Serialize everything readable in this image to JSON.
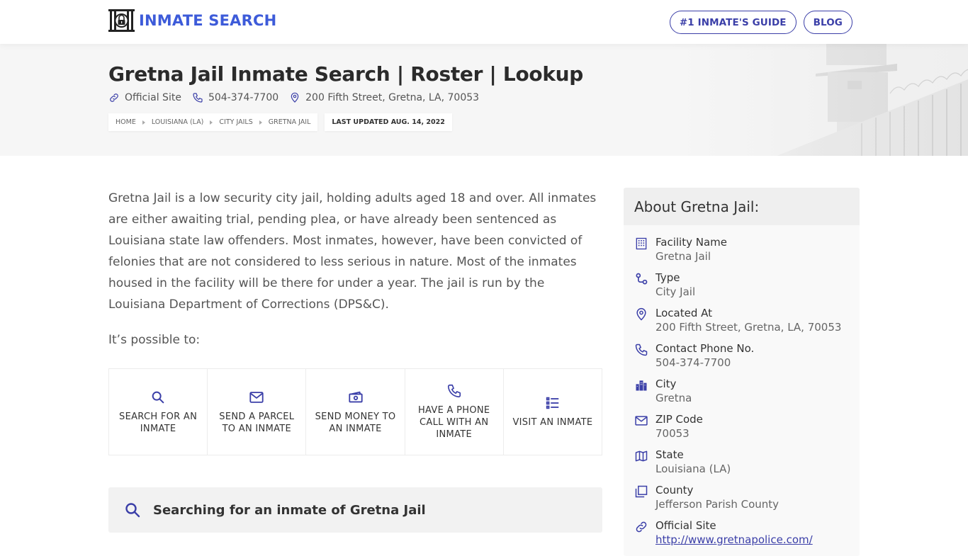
{
  "header": {
    "logo_text": "INMATE SEARCH",
    "logo_icon": "jail-lock-icon",
    "nav": [
      {
        "label": "#1 INMATE'S GUIDE"
      },
      {
        "label": "BLOG"
      }
    ]
  },
  "hero": {
    "title": "Gretna Jail Inmate Search | Roster | Lookup",
    "official_site_label": "Official Site",
    "phone": "504-374-7700",
    "address": "200 Fifth Street, Gretna, LA, 70053",
    "breadcrumbs": [
      {
        "label": "HOME"
      },
      {
        "label": "LOUISIANA (LA)"
      },
      {
        "label": "CITY JAILS"
      },
      {
        "label": "GRETNA JAIL"
      }
    ],
    "last_updated": "LAST UPDATED AUG. 14, 2022"
  },
  "main": {
    "intro": "Gretna Jail is a low security city jail, holding adults aged 18 and over. All inmates are either awaiting trial, pending plea, or have already been sentenced as Louisiana state law offenders. Most inmates, however, have been convicted of felonies that are not considered to less serious in nature. Most of the inmates housed in the facility will be there for under a year. The jail is run by the Louisiana Department of Corrections (DPS&C).",
    "possible_label": "It’s possible to:",
    "actions": [
      {
        "label": "SEARCH FOR AN INMATE",
        "icon": "search-icon"
      },
      {
        "label": "SEND A PARCEL TO AN INMATE",
        "icon": "envelope-icon"
      },
      {
        "label": "SEND MONEY TO AN INMATE",
        "icon": "money-icon"
      },
      {
        "label": "HAVE A PHONE CALL WITH AN INMATE",
        "icon": "phone-icon"
      },
      {
        "label": "VISIT AN INMATE",
        "icon": "list-icon"
      }
    ],
    "search_section_title": "Searching for an inmate of Gretna Jail"
  },
  "sidebar": {
    "title": "About Gretna Jail:",
    "items": [
      {
        "label": "Facility Name",
        "value": "Gretna Jail",
        "icon": "building-icon"
      },
      {
        "label": "Type",
        "value": "City Jail",
        "icon": "route-icon"
      },
      {
        "label": "Located At",
        "value": "200 Fifth Street, Gretna, LA, 70053",
        "icon": "map-pin-icon"
      },
      {
        "label": "Contact Phone No.",
        "value": "504-374-7700",
        "icon": "phone-icon"
      },
      {
        "label": "City",
        "value": "Gretna",
        "icon": "city-icon"
      },
      {
        "label": "ZIP Code",
        "value": "70053",
        "icon": "envelope-icon"
      },
      {
        "label": "State",
        "value": "Louisiana (LA)",
        "icon": "map-icon"
      },
      {
        "label": "County",
        "value": "Jefferson Parish County",
        "icon": "copy-icon"
      },
      {
        "label": "Official Site",
        "value": "http://www.gretnapolice.com/",
        "icon": "link-icon"
      }
    ]
  },
  "colors": {
    "accent": "#3b3fa8",
    "logo_blue": "#3d5bd9",
    "hero_bg": "#f6f6f6",
    "sidebar_bg": "#f9f9f9",
    "sidebar_head_bg": "#efefef",
    "search_bar_bg": "#f2f2f2"
  }
}
